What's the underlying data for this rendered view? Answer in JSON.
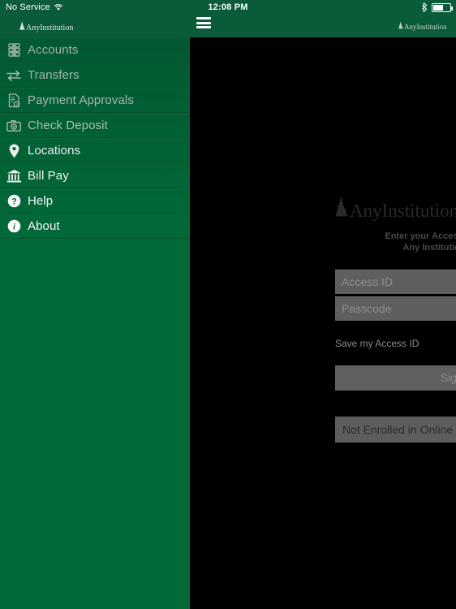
{
  "status_bar": {
    "carrier": "No Service",
    "wifi_icon": "wifi-icon",
    "time": "12:08 PM",
    "bluetooth_icon": "bluetooth-icon",
    "battery_icon": "battery-icon"
  },
  "nav_bar": {
    "logo_left": "AnyInstitution",
    "logo_right": "AnyInstitution",
    "menu_icon": "hamburger-menu-icon"
  },
  "sidebar": {
    "items": [
      {
        "label": "Accounts",
        "icon": "accounts-icon",
        "state": "dim"
      },
      {
        "label": "Transfers",
        "icon": "transfers-icon",
        "state": "dim"
      },
      {
        "label": "Payment Approvals",
        "icon": "payment-approvals-icon",
        "state": "dim"
      },
      {
        "label": "Check Deposit",
        "icon": "camera-icon",
        "state": "dim"
      },
      {
        "label": "Locations",
        "icon": "location-pin-icon",
        "state": "bright"
      },
      {
        "label": "Bill Pay",
        "icon": "bank-icon",
        "state": "bright"
      },
      {
        "label": "Help",
        "icon": "question-circle-icon",
        "state": "bright"
      },
      {
        "label": "About",
        "icon": "info-circle-icon",
        "state": "bright"
      }
    ]
  },
  "login": {
    "logo": "AnyInstitution",
    "instruction_line1": "Enter your Access ID and Passcode",
    "instruction_line2": "Any Institution Commercial",
    "access_id_placeholder": "Access ID",
    "access_id_value": "",
    "passcode_placeholder": "Passcode",
    "passcode_value": "",
    "save_access_id_label": "Save my Access ID",
    "sign_on_label": "Sign On",
    "not_enrolled_label": "Not Enrolled in Online Banking?"
  },
  "colors": {
    "brand_green": "#02693a",
    "navbar_green": "#0a5b37",
    "overlay_black": "#000000",
    "field_grey": "#5f5f5f",
    "button_grey": "#606060"
  }
}
